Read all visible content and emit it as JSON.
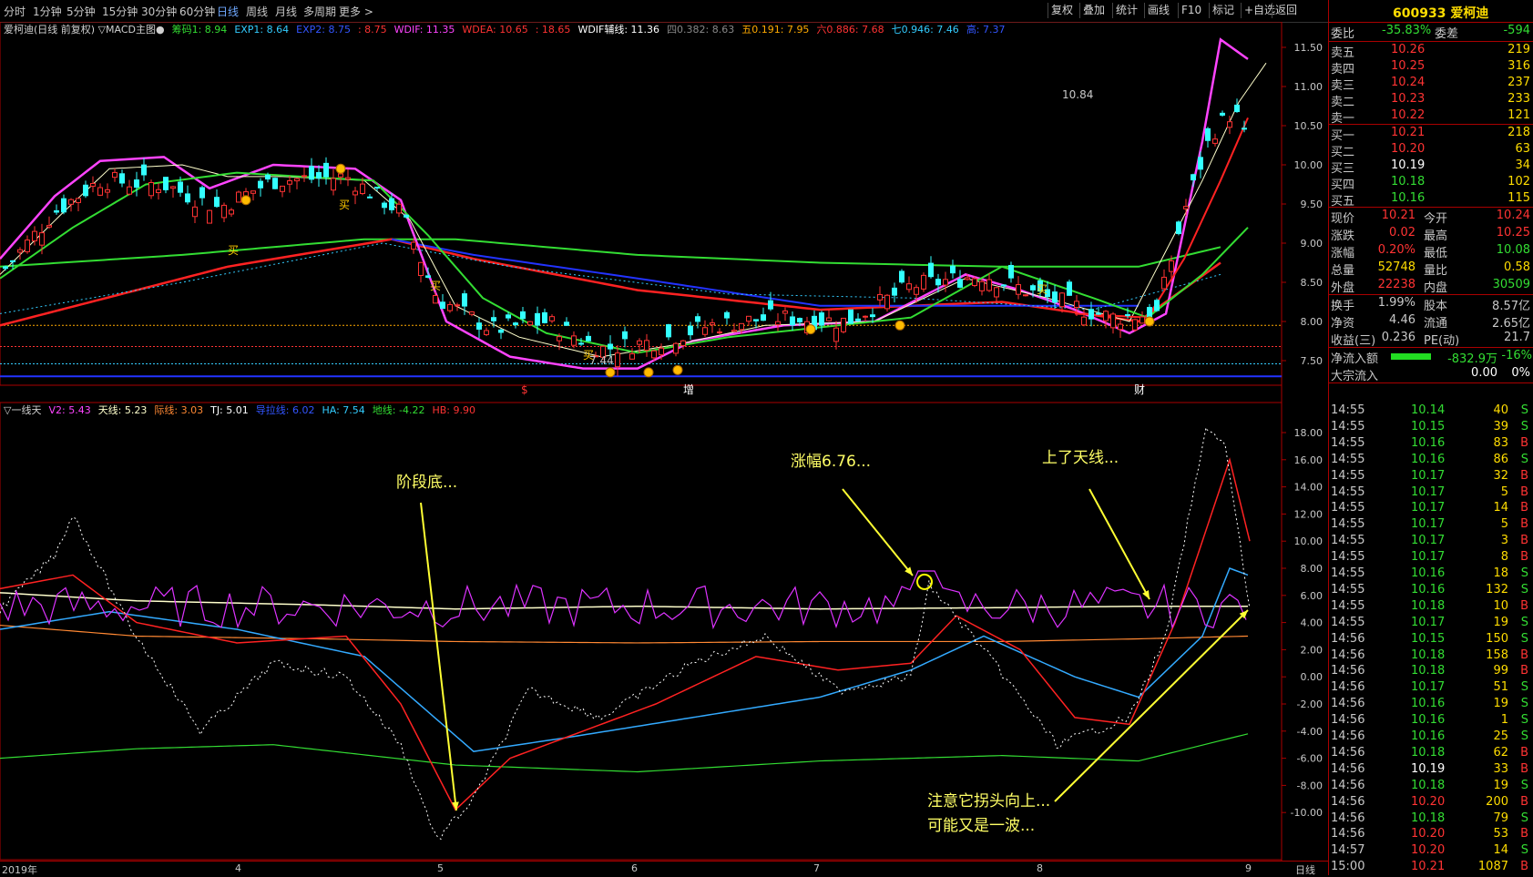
{
  "toolbar": {
    "periods": [
      "分时",
      "1分钟",
      "5分钟",
      "15分钟",
      "30分钟",
      "60分钟",
      "日线",
      "周线",
      "月线",
      "多周期",
      "更多 >"
    ],
    "active_period": "日线",
    "buttons": [
      "复权",
      "叠加",
      "统计",
      "画线",
      "F10",
      "标记",
      "+自选",
      "返回"
    ]
  },
  "main_chart": {
    "header": [
      {
        "t": "爱柯迪(日线 前复权) ▽MACD主图●",
        "c": "#d0d0d0"
      },
      {
        "t": "筹码1: 8.94",
        "c": "#33dd33"
      },
      {
        "t": "EXP1: 8.64",
        "c": "#33ccff"
      },
      {
        "t": "EXP2: 8.75",
        "c": "#3355ff"
      },
      {
        "t": ": 8.75",
        "c": "#ff3333"
      },
      {
        "t": "WDIF: 11.35",
        "c": "#ff44ff"
      },
      {
        "t": "WDEA: 10.65",
        "c": "#ff3333"
      },
      {
        "t": ": 18.65",
        "c": "#ff3333"
      },
      {
        "t": "WDIF辅线: 11.36",
        "c": "#ffffff"
      },
      {
        "t": "四0.382: 8.63",
        "c": "#888888"
      },
      {
        "t": "五0.191: 7.95",
        "c": "#ffaa00"
      },
      {
        "t": "六0.886: 7.68",
        "c": "#ff3333"
      },
      {
        "t": "七0.946: 7.46",
        "c": "#33ccff"
      },
      {
        "t": "高: 7.37",
        "c": "#3355ff"
      }
    ],
    "y_ticks": [
      "11.50",
      "11.00",
      "10.50",
      "10.00",
      "9.50",
      "9.00",
      "8.50",
      "8.00",
      "7.50"
    ],
    "annotations": [
      {
        "t": "买",
        "c": "#ffcc00"
      },
      {
        "t": "买",
        "c": "#ffcc00"
      },
      {
        "t": "买",
        "c": "#ffcc00"
      },
      {
        "t": "买",
        "c": "#ffcc00"
      },
      {
        "t": "买",
        "c": "#ffcc00"
      },
      {
        "t": "10.84",
        "c": "#c8c8c8"
      },
      {
        "t": "7.44",
        "c": "#c8c8c8"
      },
      {
        "t": "增",
        "c": "#ffffff"
      },
      {
        "t": "财",
        "c": "#ffffff"
      },
      {
        "t": "$",
        "c": "#ff3333"
      }
    ]
  },
  "sub_chart": {
    "header": [
      {
        "t": "▽一线天",
        "c": "#d0d0d0"
      },
      {
        "t": "V2: 5.43",
        "c": "#ff44ff"
      },
      {
        "t": "天线: 5.23",
        "c": "#ffffcc"
      },
      {
        "t": "际线: 3.03",
        "c": "#ff8833"
      },
      {
        "t": "TJ: 5.01",
        "c": "#ffffff"
      },
      {
        "t": "导拉线: 6.02",
        "c": "#3355ff"
      },
      {
        "t": "HA: 7.54",
        "c": "#33ccff"
      },
      {
        "t": "地线: -4.22",
        "c": "#33dd33"
      },
      {
        "t": "HB: 9.90",
        "c": "#ff3333"
      }
    ],
    "y_ticks": [
      "18.00",
      "16.00",
      "14.00",
      "12.00",
      "10.00",
      "8.00",
      "6.00",
      "4.00",
      "2.00",
      "0.00",
      "-2.00",
      "-4.00",
      "-6.00",
      "-8.00",
      "-10.00"
    ],
    "notes": [
      "阶段底...",
      "涨幅6.76...",
      "上了天线...",
      "注意它拐头向上...",
      "可能又是一波..."
    ]
  },
  "x_axis": [
    "2019年",
    "4",
    "5",
    "6",
    "7",
    "8",
    "9"
  ],
  "x_axis_right": "日线",
  "panel": {
    "title": "600933 爱柯迪",
    "weibi_label": "委比",
    "weibi": "-35.83%",
    "weicha_label": "委差",
    "weicha": "-594",
    "asks": [
      {
        "label": "卖五",
        "price": "10.26",
        "vol": "219"
      },
      {
        "label": "卖四",
        "price": "10.25",
        "vol": "316"
      },
      {
        "label": "卖三",
        "price": "10.24",
        "vol": "237"
      },
      {
        "label": "卖二",
        "price": "10.23",
        "vol": "233"
      },
      {
        "label": "卖一",
        "price": "10.22",
        "vol": "121"
      }
    ],
    "bids": [
      {
        "label": "买一",
        "price": "10.21",
        "vol": "218"
      },
      {
        "label": "买二",
        "price": "10.20",
        "vol": "63"
      },
      {
        "label": "买三",
        "price": "10.19",
        "vol": "34"
      },
      {
        "label": "买四",
        "price": "10.18",
        "vol": "102"
      },
      {
        "label": "买五",
        "price": "10.16",
        "vol": "115"
      }
    ],
    "quote": [
      {
        "l1": "现价",
        "v1": "10.21",
        "c1": "#ff3333",
        "l2": "今开",
        "v2": "10.24",
        "c2": "#ff3333"
      },
      {
        "l1": "涨跌",
        "v1": "0.02",
        "c1": "#ff3333",
        "l2": "最高",
        "v2": "10.25",
        "c2": "#ff3333"
      },
      {
        "l1": "涨幅",
        "v1": "0.20%",
        "c1": "#ff3333",
        "l2": "最低",
        "v2": "10.08",
        "c2": "#33dd33"
      },
      {
        "l1": "总量",
        "v1": "52748",
        "c1": "#ffdd00",
        "l2": "量比",
        "v2": "0.58",
        "c2": "#ffdd00"
      },
      {
        "l1": "外盘",
        "v1": "22238",
        "c1": "#ff3333",
        "l2": "内盘",
        "v2": "30509",
        "c2": "#33dd33"
      }
    ],
    "fund": [
      {
        "l1": "换手",
        "v1": "1.99%",
        "l2": "股本",
        "v2": "8.57亿"
      },
      {
        "l1": "净资",
        "v1": "4.46",
        "l2": "流通",
        "v2": "2.65亿"
      },
      {
        "l1": "收益(三)",
        "v1": "0.236",
        "l2": "PE(动)",
        "v2": "21.7"
      }
    ],
    "netflow_label": "净流入额",
    "netflow": "-832.9万",
    "netflow_pct": "-16%",
    "bigflow_label": "大宗流入",
    "bigflow": "0.00",
    "bigflow_pct": "0%",
    "ticks": [
      {
        "t": "14:55",
        "p": "10.14",
        "pc": "#33dd33",
        "v": "40",
        "d": "S"
      },
      {
        "t": "14:55",
        "p": "10.15",
        "pc": "#33dd33",
        "v": "39",
        "d": "S"
      },
      {
        "t": "14:55",
        "p": "10.16",
        "pc": "#33dd33",
        "v": "83",
        "d": "B"
      },
      {
        "t": "14:55",
        "p": "10.16",
        "pc": "#33dd33",
        "v": "86",
        "d": "S"
      },
      {
        "t": "14:55",
        "p": "10.17",
        "pc": "#33dd33",
        "v": "32",
        "d": "B"
      },
      {
        "t": "14:55",
        "p": "10.17",
        "pc": "#33dd33",
        "v": "5",
        "d": "B"
      },
      {
        "t": "14:55",
        "p": "10.17",
        "pc": "#33dd33",
        "v": "14",
        "d": "B"
      },
      {
        "t": "14:55",
        "p": "10.17",
        "pc": "#33dd33",
        "v": "5",
        "d": "B"
      },
      {
        "t": "14:55",
        "p": "10.17",
        "pc": "#33dd33",
        "v": "3",
        "d": "B"
      },
      {
        "t": "14:55",
        "p": "10.17",
        "pc": "#33dd33",
        "v": "8",
        "d": "B"
      },
      {
        "t": "14:55",
        "p": "10.16",
        "pc": "#33dd33",
        "v": "18",
        "d": "S"
      },
      {
        "t": "14:55",
        "p": "10.16",
        "pc": "#33dd33",
        "v": "132",
        "d": "S"
      },
      {
        "t": "14:55",
        "p": "10.18",
        "pc": "#33dd33",
        "v": "10",
        "d": "B"
      },
      {
        "t": "14:55",
        "p": "10.17",
        "pc": "#33dd33",
        "v": "19",
        "d": "S"
      },
      {
        "t": "14:56",
        "p": "10.15",
        "pc": "#33dd33",
        "v": "150",
        "d": "S"
      },
      {
        "t": "14:56",
        "p": "10.18",
        "pc": "#33dd33",
        "v": "158",
        "d": "B"
      },
      {
        "t": "14:56",
        "p": "10.18",
        "pc": "#33dd33",
        "v": "99",
        "d": "B"
      },
      {
        "t": "14:56",
        "p": "10.17",
        "pc": "#33dd33",
        "v": "51",
        "d": "S"
      },
      {
        "t": "14:56",
        "p": "10.16",
        "pc": "#33dd33",
        "v": "19",
        "d": "S"
      },
      {
        "t": "14:56",
        "p": "10.16",
        "pc": "#33dd33",
        "v": "1",
        "d": "S"
      },
      {
        "t": "14:56",
        "p": "10.16",
        "pc": "#33dd33",
        "v": "25",
        "d": "S"
      },
      {
        "t": "14:56",
        "p": "10.18",
        "pc": "#33dd33",
        "v": "62",
        "d": "B"
      },
      {
        "t": "14:56",
        "p": "10.19",
        "pc": "#ffffff",
        "v": "33",
        "d": "B"
      },
      {
        "t": "14:56",
        "p": "10.18",
        "pc": "#33dd33",
        "v": "19",
        "d": "S"
      },
      {
        "t": "14:56",
        "p": "10.20",
        "pc": "#ff3333",
        "v": "200",
        "d": "B"
      },
      {
        "t": "14:56",
        "p": "10.18",
        "pc": "#33dd33",
        "v": "79",
        "d": "S"
      },
      {
        "t": "14:56",
        "p": "10.20",
        "pc": "#ff3333",
        "v": "53",
        "d": "B"
      },
      {
        "t": "14:57",
        "p": "10.20",
        "pc": "#ff3333",
        "v": "14",
        "d": "S"
      },
      {
        "t": "15:00",
        "p": "10.21",
        "pc": "#ff3333",
        "v": "1087",
        "d": "B"
      }
    ]
  }
}
